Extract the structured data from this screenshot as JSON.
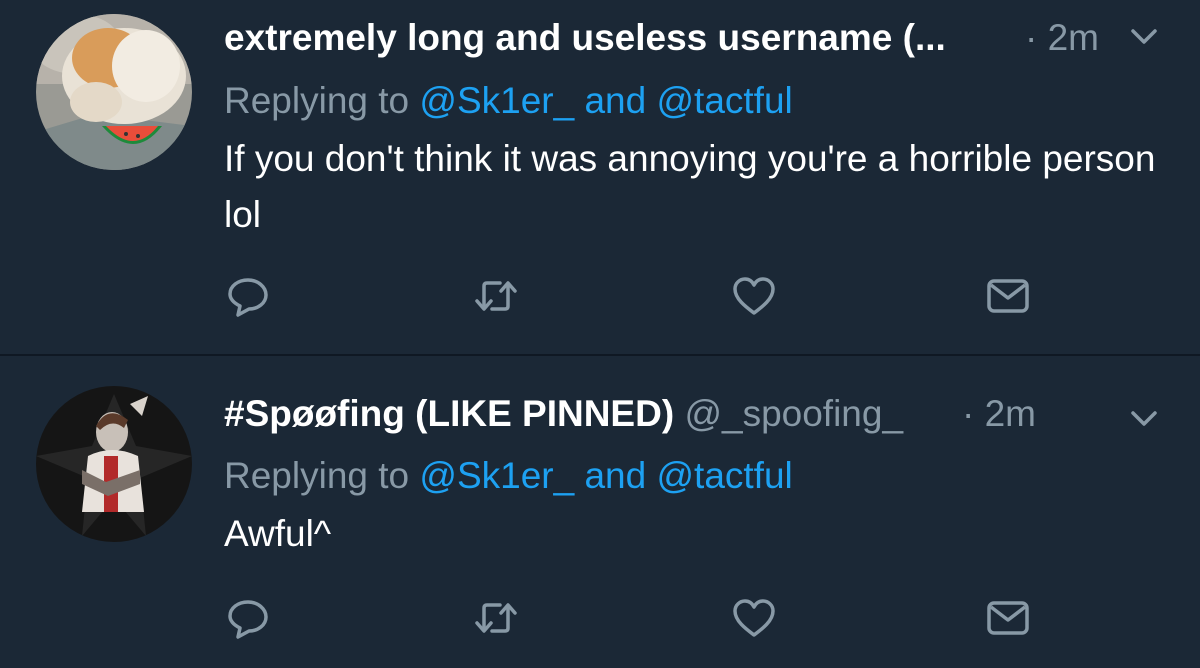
{
  "colors": {
    "background": "#1b2836",
    "divider": "#0f1823",
    "primary_text": "#ffffff",
    "secondary_text": "#8899a6",
    "link": "#1da1f2",
    "icon": "#8899a6"
  },
  "tweets": [
    {
      "author_name": "extremely long and useless username (...",
      "handle": "",
      "separator": "·",
      "time": "2m",
      "replying_label": "Replying to",
      "mention_1": "@Sk1er_",
      "mention_joiner": "and",
      "mention_2": "@tactful",
      "text": "If you don't think it was annoying you're a horrible person lol",
      "avatar_icon": "cat-eating-watermelon-avatar",
      "actions": [
        "reply-icon",
        "retweet-icon",
        "like-icon",
        "direct-message-icon"
      ]
    },
    {
      "author_name": "#Spøøfing (LIKE PINNED)",
      "handle": "@_spoofing_",
      "separator": "·",
      "time": "2m",
      "replying_label": "Replying to",
      "mention_1": "@Sk1er_",
      "mention_joiner": "and",
      "mention_2": "@tactful",
      "text": "Awful^",
      "avatar_icon": "hooded-character-logo-avatar",
      "actions": [
        "reply-icon",
        "retweet-icon",
        "like-icon",
        "direct-message-icon"
      ]
    }
  ]
}
